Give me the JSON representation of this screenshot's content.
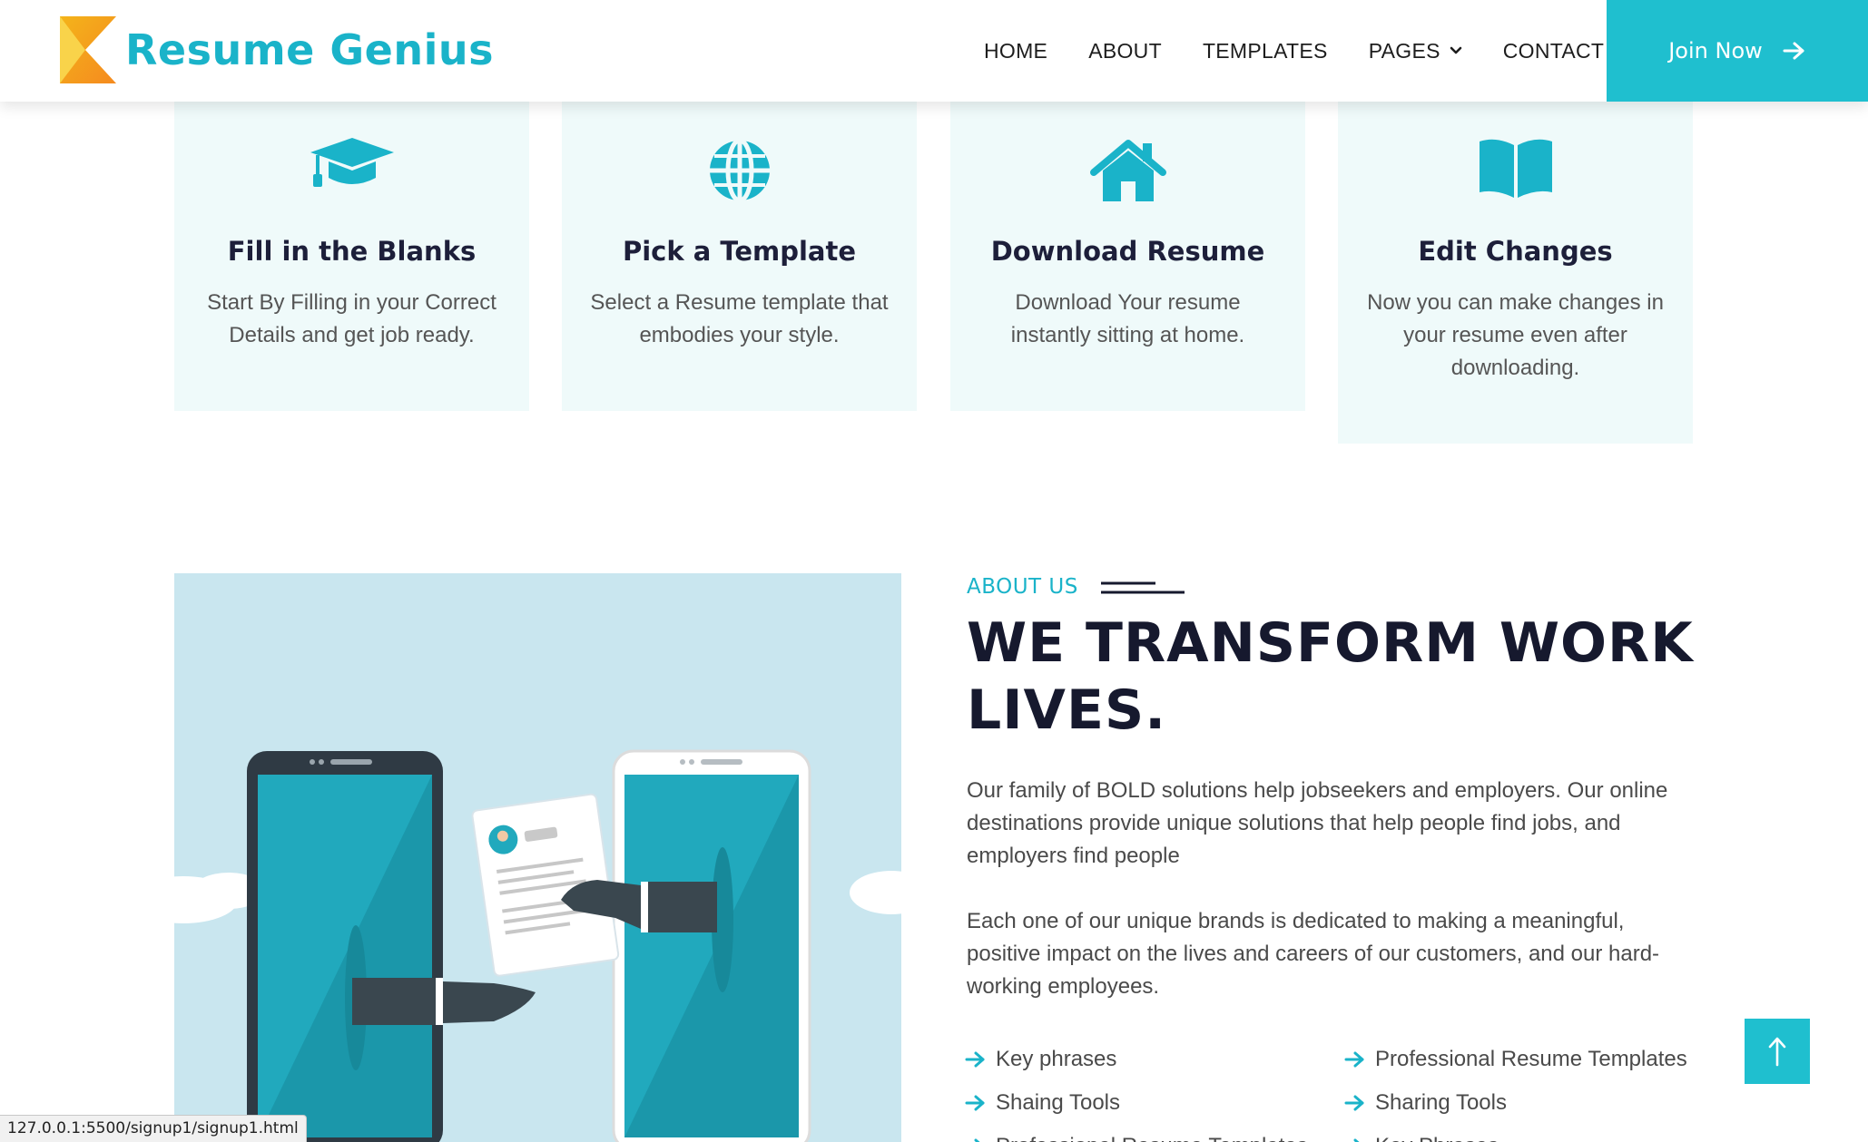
{
  "header": {
    "logo_text": "Resume Genius",
    "nav": [
      "HOME",
      "ABOUT",
      "TEMPLATES",
      "PAGES",
      "CONTACT"
    ],
    "join_label": "Join Now"
  },
  "features": [
    {
      "icon": "graduation-cap-icon",
      "title": "Fill in the Blanks",
      "text": "Start By Filling in your Correct Details and get job ready."
    },
    {
      "icon": "globe-icon",
      "title": "Pick a Template",
      "text": "Select a Resume template that embodies your style."
    },
    {
      "icon": "home-icon",
      "title": "Download Resume",
      "text": "Download Your resume instantly sitting at home."
    },
    {
      "icon": "book-open-icon",
      "title": "Edit Changes",
      "text": "Now you can make changes in your resume even after downloading."
    }
  ],
  "about": {
    "tag": "ABOUT US",
    "title": "WE TRANSFORM WORK LIVES.",
    "para1": "Our family of BOLD solutions help jobseekers and employers. Our online destinations provide unique solutions that help people find jobs, and employers find people",
    "para2": "Each one of our unique brands is dedicated to making a meaningful, positive impact on the lives and careers of our customers, and our hard-working employees.",
    "list_left": [
      "Key phrases",
      "Shaing Tools",
      "Professional Resume Templates"
    ],
    "list_right": [
      "Professional Resume Templates",
      "Sharing Tools",
      "Key Phrases"
    ]
  },
  "status_url": "127.0.0.1:5500/signup1/signup1.html",
  "colors": {
    "accent": "#1fbfcf",
    "heading": "#16192e",
    "card_bg": "#effafa",
    "image_bg": "#c9e6ef"
  }
}
